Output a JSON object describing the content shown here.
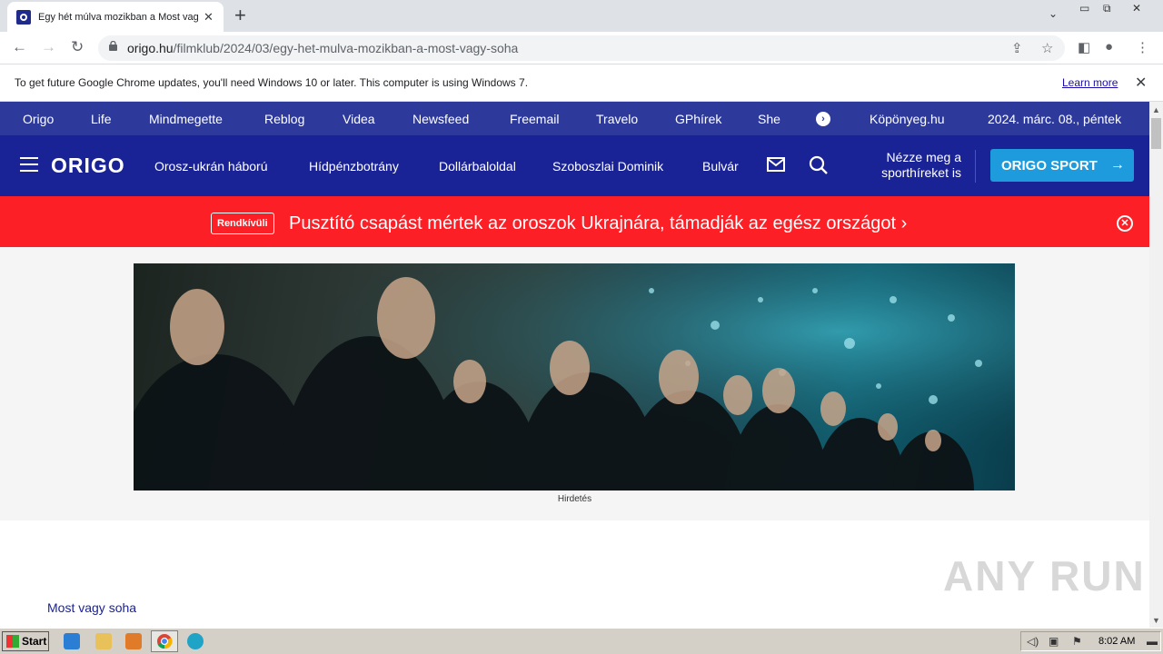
{
  "browser": {
    "tab_title": "Egy hét múlva mozikban a Most vagy soha",
    "url_domain": "origo.hu",
    "url_path": "/filmklub/2024/03/egy-het-mulva-mozikban-a-most-vagy-soha",
    "infobar_text": "To get future Google Chrome updates, you'll need Windows 10 or later. This computer is using Windows 7.",
    "infobar_link": "Learn more"
  },
  "topnav": {
    "items": [
      "Origo",
      "Life",
      "Mindmegette",
      "Reblog",
      "Videa",
      "Newsfeed",
      "Freemail",
      "Travelo",
      "GPhírek",
      "She"
    ],
    "extra": "Köpönyeg.hu",
    "date": "2024. márc. 08., péntek"
  },
  "mainnav": {
    "logo": "ORIGO",
    "items": [
      "Orosz-ukrán háború",
      "Hídpénzbotrány",
      "Dollárbaloldal",
      "Szoboszlai Dominik",
      "Bulvár"
    ],
    "sport_text": "Nézze meg a sporthíreket is",
    "sport_button": "ORIGO SPORT"
  },
  "breaking": {
    "badge": "Rendkívüli",
    "headline": "Pusztító csapást mértek az oroszok Ukrajnára, támadják az egész országot"
  },
  "ad": {
    "label": "Hirdetés"
  },
  "article": {
    "breadcrumb": "Most vagy soha"
  },
  "watermark": "ANY RUN",
  "taskbar": {
    "start": "Start",
    "clock": "8:02 AM"
  },
  "colors": {
    "topnav_bg": "#2d3a9b",
    "mainnav_bg": "#1a2395",
    "breaking_bg": "#fc1f25",
    "sport_btn": "#1e9bdc"
  }
}
